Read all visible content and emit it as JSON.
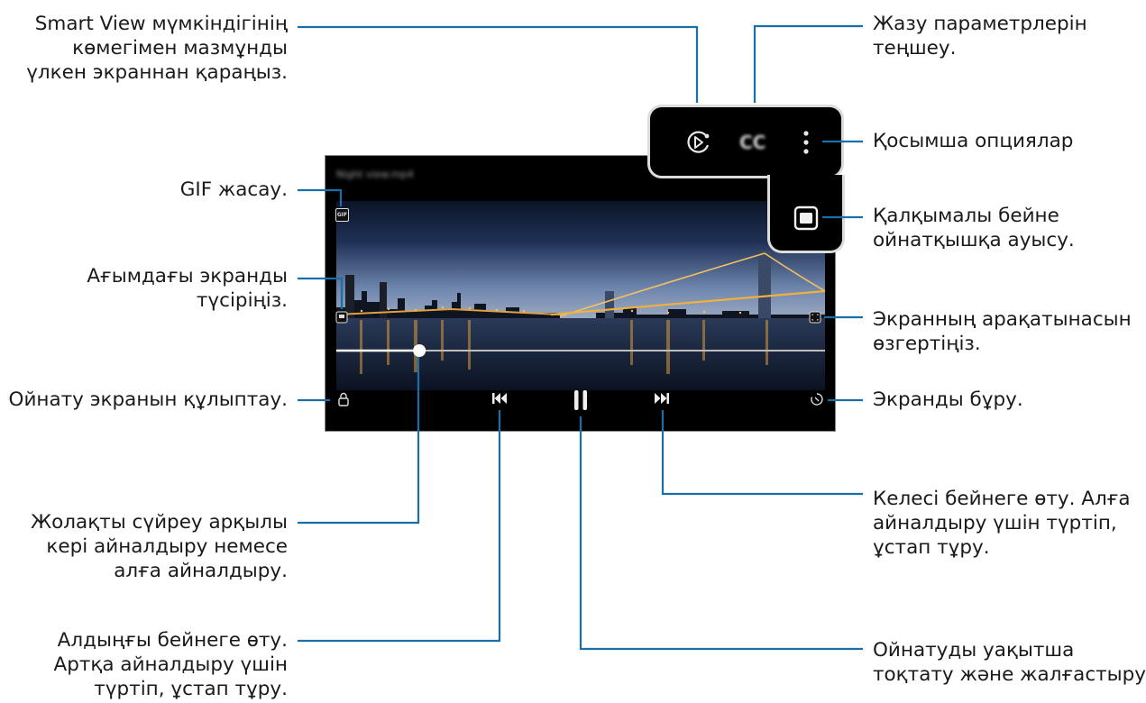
{
  "labels": {
    "smart_view": [
      "Smart View мүмкіндігінің",
      "көмегімен мазмұнды",
      "үлкен экраннан қараңыз."
    ],
    "gif": [
      "GIF жасау."
    ],
    "capture": [
      "Ағымдағы экранды",
      "түсіріңіз."
    ],
    "lock": [
      "Ойнату экранын құлыптау."
    ],
    "seek": [
      "Жолақты сүйреу арқылы",
      "кері айналдыру немесе",
      "алға айналдыру."
    ],
    "previous": [
      "Алдыңғы бейнеге өту.",
      "Артқа айналдыру үшін",
      "түртіп, ұстап тұру."
    ],
    "subtitles": [
      "Жазу параметрлерін",
      "теңшеу."
    ],
    "more_options": [
      "Қосымша опциялар"
    ],
    "popup_player": [
      "Қалқымалы бейне",
      "ойнатқышқа ауысу."
    ],
    "aspect_ratio": [
      "Экранның арақатынасын",
      "өзгертіңіз."
    ],
    "rotate": [
      "Экранды бұру."
    ],
    "next": [
      "Келесі бейнеге өту. Алға",
      "айналдыру үшін түртіп,",
      "ұстап тұру."
    ],
    "pause": [
      "Ойнатуды уақытша",
      "тоқтату және жалғастыру."
    ]
  },
  "player": {
    "video_title": "Night view.mp4",
    "gif_icon_text": "GIF",
    "cc_text": "CC",
    "progress": 0.17
  },
  "icons": [
    "smart-view-icon",
    "subtitles-icon",
    "more-options-icon",
    "popup-player-icon",
    "gif-icon",
    "capture-icon",
    "lock-icon",
    "aspect-ratio-icon",
    "rotate-icon",
    "previous-icon",
    "pause-icon",
    "next-icon"
  ],
  "colors": {
    "leader": "#1a6fa8",
    "screen_bg": "#000000",
    "sky_top": "#1f3156",
    "sky_bottom": "#7e93b5",
    "city_lights": "#f0b040"
  }
}
